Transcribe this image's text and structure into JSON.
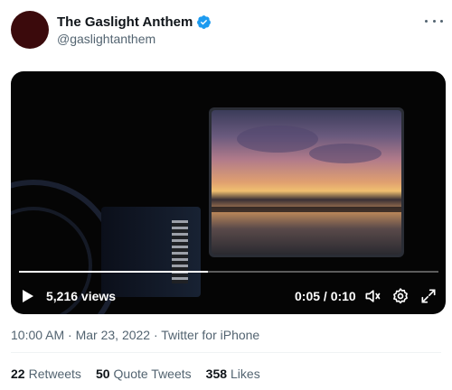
{
  "author": {
    "display_name": "The Gaslight Anthem",
    "handle": "@gaslightanthem",
    "avatar_color": "#3b0a0c",
    "verified_color": "#1d9bf0"
  },
  "video": {
    "views": "5,216 views",
    "time": "0:05 / 0:10",
    "progress": 0.45,
    "icons": [
      "play-icon",
      "volume-icon",
      "settings-icon",
      "fullscreen-icon"
    ]
  },
  "meta": {
    "timestamp": "10:00 AM · Mar 23, 2022 · Twitter for iPhone"
  },
  "stats": [
    {
      "count": "22",
      "label": "Retweets"
    },
    {
      "count": "50",
      "label": "Quote Tweets"
    },
    {
      "count": "358",
      "label": "Likes"
    }
  ]
}
